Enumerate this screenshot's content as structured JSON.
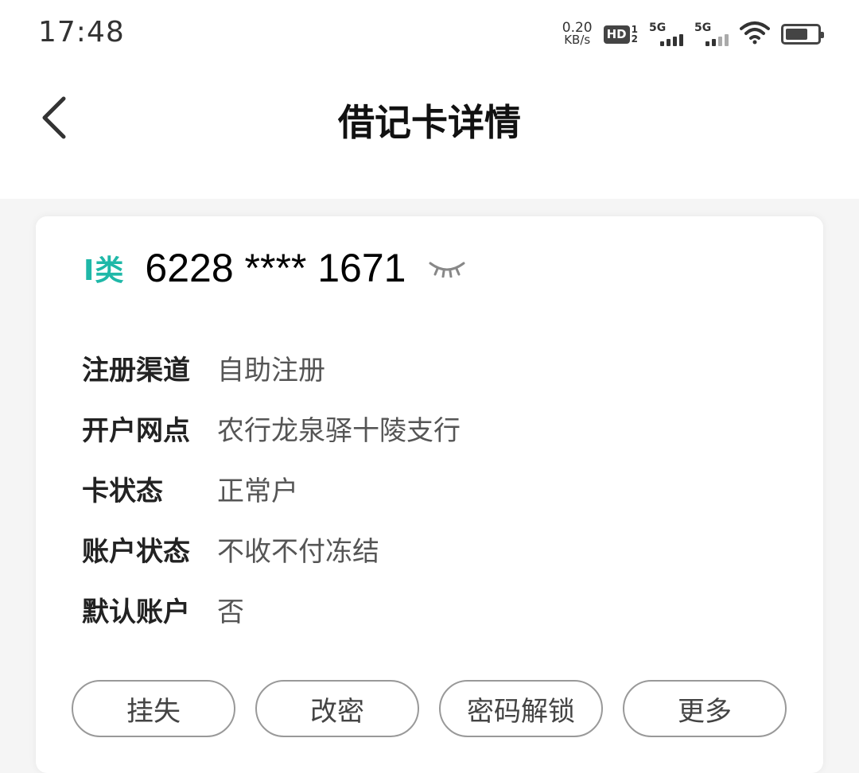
{
  "status_bar": {
    "time": "17:48",
    "net_speed_value": "0.20",
    "net_speed_unit": "KB/s",
    "hd_label": "HD",
    "hd_sub_top": "1",
    "hd_sub_bottom": "2",
    "sim1_label": "5G",
    "sim2_label": "5G",
    "icons": [
      "hd-icon",
      "signal-icon",
      "signal-icon",
      "wifi-icon",
      "battery-icon"
    ]
  },
  "nav": {
    "title": "借记卡详情",
    "back_icon": "chevron-left-icon"
  },
  "card": {
    "type_label": "I类",
    "number": "6228 **** 1671",
    "eye_icon": "eye-closed-icon",
    "accent_color": "#1fb8a8",
    "fields": [
      {
        "label": "注册渠道",
        "value": "自助注册"
      },
      {
        "label": "开户网点",
        "value": "农行龙泉驿十陵支行"
      },
      {
        "label": "卡状态",
        "value": "正常户"
      },
      {
        "label": "账户状态",
        "value": "不收不付冻结"
      },
      {
        "label": "默认账户",
        "value": "否"
      }
    ],
    "actions": [
      {
        "label": "挂失"
      },
      {
        "label": "改密"
      },
      {
        "label": "密码解锁"
      },
      {
        "label": "更多"
      }
    ]
  }
}
